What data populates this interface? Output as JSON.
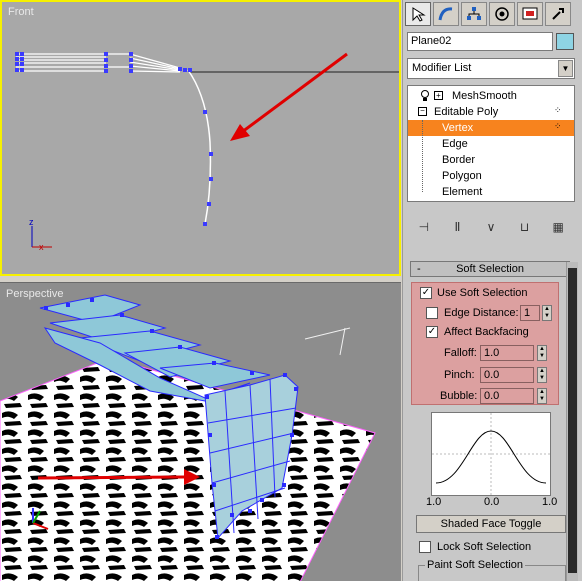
{
  "viewports": {
    "front": {
      "label": "Front"
    },
    "perspective": {
      "label": "Perspective"
    },
    "axis": {
      "x": "x",
      "y": "y",
      "z": "z"
    }
  },
  "command_panel": {
    "tabs": [
      {
        "icon": "create-icon",
        "active": true
      },
      {
        "icon": "modify-icon",
        "active": false
      },
      {
        "icon": "hierarchy-icon",
        "active": false
      },
      {
        "icon": "motion-icon",
        "active": false
      },
      {
        "icon": "display-icon",
        "active": false
      },
      {
        "icon": "utilities-icon",
        "active": false
      }
    ],
    "object_name": "Plane02",
    "object_color": "#8ed4e4",
    "modifier_list": "Modifier List",
    "stack": {
      "meshsmooth": "MeshSmooth",
      "editable_poly": "Editable Poly",
      "vertex": "Vertex",
      "edge": "Edge",
      "border": "Border",
      "polygon": "Polygon",
      "element": "Element"
    },
    "soft_selection": {
      "title": "Soft Selection",
      "minus": "-",
      "use_soft_selection": "Use Soft Selection",
      "edge_distance": "Edge Distance:",
      "edge_distance_value": "1",
      "affect_backfacing": "Affect Backfacing",
      "falloff_label": "Falloff:",
      "falloff_value": "1.0",
      "pinch_label": "Pinch:",
      "pinch_value": "0.0",
      "bubble_label": "Bubble:",
      "bubble_value": "0.0",
      "curve_x_left": "1.0",
      "curve_x_mid": "0.0",
      "curve_x_right": "1.0",
      "shaded_face_toggle": "Shaded Face Toggle",
      "lock_soft_selection": "Lock Soft Selection",
      "paint_soft_selection": "Paint Soft Selection"
    },
    "colors": {
      "selection": "#f7831e",
      "highlight": "#dca0a0",
      "arrow": "#e00000"
    }
  }
}
